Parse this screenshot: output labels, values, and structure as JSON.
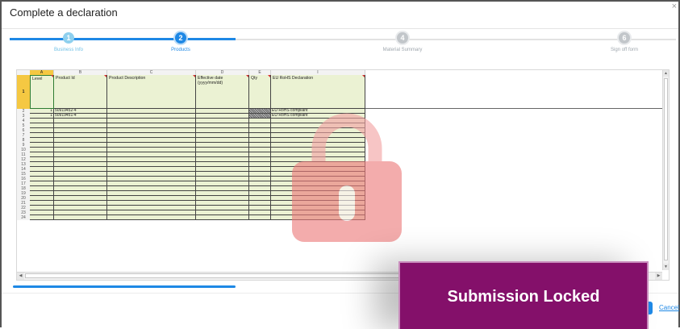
{
  "dialog": {
    "title": "Complete a declaration",
    "close_glyph": "×"
  },
  "stepper": {
    "steps": [
      {
        "number": "1",
        "label": "Business Info"
      },
      {
        "number": "2",
        "label": "Products"
      },
      {
        "number": "4",
        "label": "Material Summary"
      },
      {
        "number": "6",
        "label": "Sign off form"
      }
    ],
    "current_step": 2
  },
  "sheet": {
    "column_letters": [
      "A",
      "B",
      "C",
      "D",
      "E",
      "I"
    ],
    "headers": [
      "Level",
      "Product Id",
      "Product Description",
      "Effective date (yyyy/mm/dd)",
      "Qty",
      "EU RoHS Declaration"
    ],
    "header_row_number": "1",
    "rows": [
      {
        "num": "2",
        "level": "1",
        "product_id": "50919452-4",
        "description": "",
        "date": "",
        "qty": "",
        "declaration": "EU RoHS compliant"
      },
      {
        "num": "3",
        "level": "1",
        "product_id": "50919451-4",
        "description": "",
        "date": "",
        "qty": "",
        "declaration": "EU RoHS compliant"
      }
    ],
    "empty_row_numbers": [
      "4",
      "5",
      "6",
      "7",
      "8",
      "9",
      "10",
      "11",
      "12",
      "13",
      "14",
      "15",
      "16",
      "17",
      "18",
      "19",
      "20",
      "21",
      "22",
      "23",
      "24"
    ]
  },
  "overlay": {
    "text": "Submission Locked",
    "icon": "lock-icon",
    "color": "#84106a"
  },
  "footer": {
    "cancel_label": "Cancel"
  },
  "colors": {
    "accent": "#1e88e5",
    "sheet_fill": "#ebf2d3",
    "lock": "#f08c8c"
  }
}
